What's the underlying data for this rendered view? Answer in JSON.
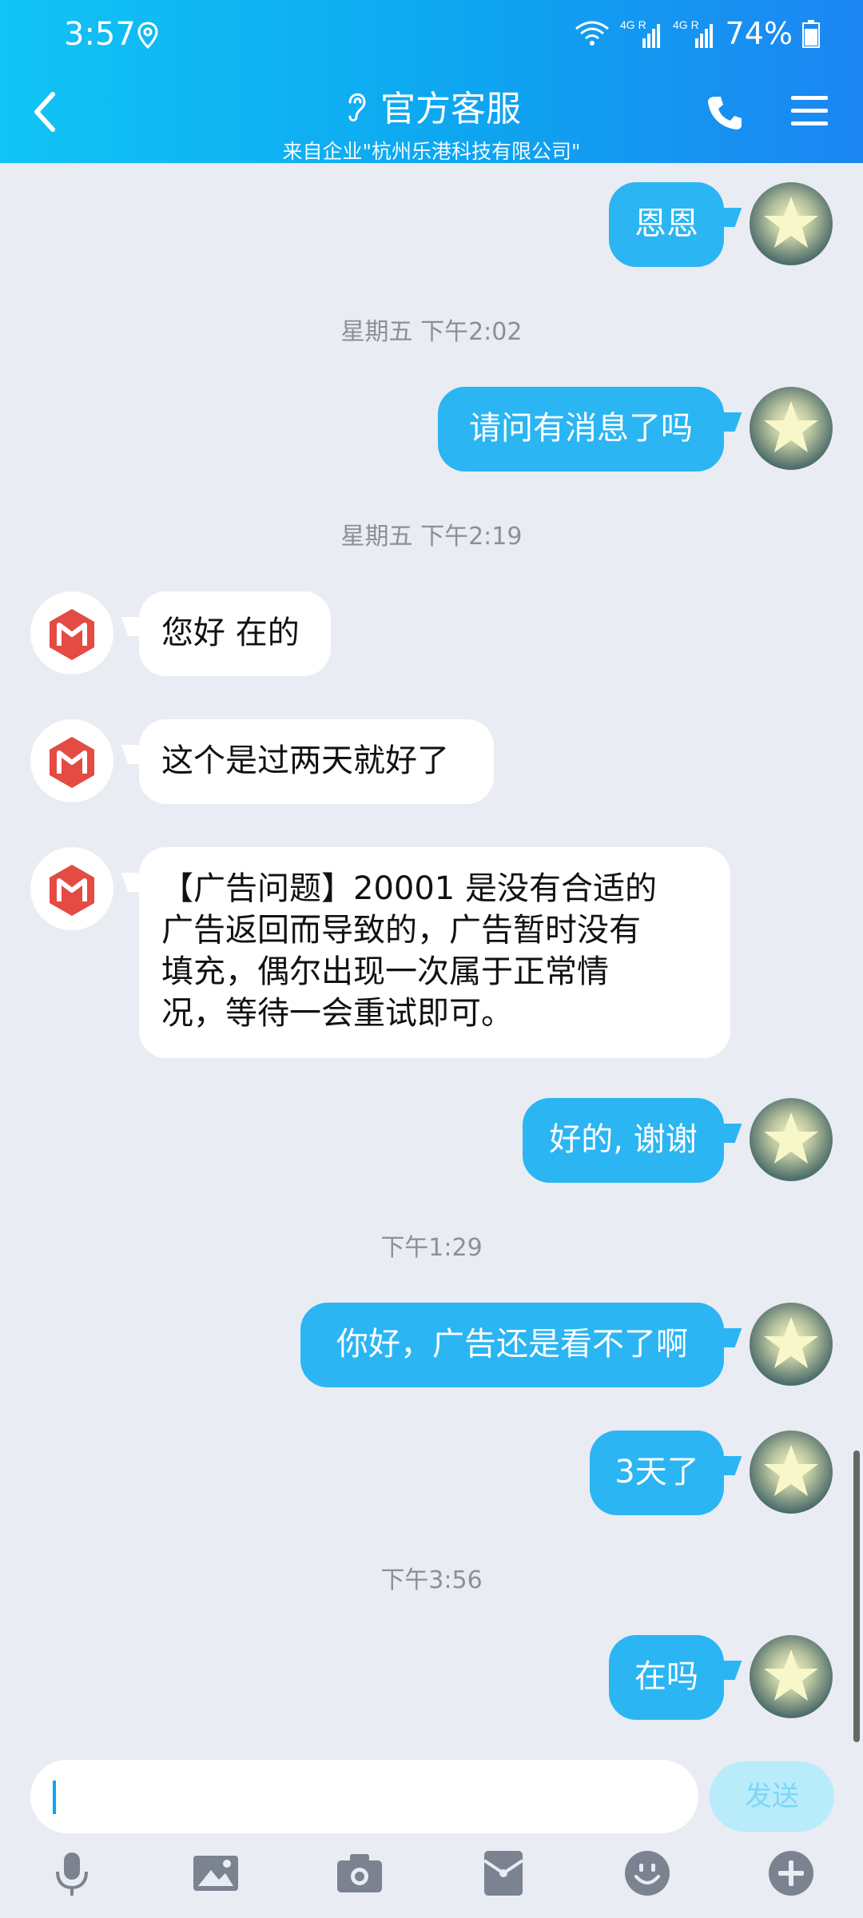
{
  "status_bar": {
    "time": "3:57",
    "battery": "74%",
    "net1": "4G R",
    "net2": "4G R"
  },
  "header": {
    "title": "官方客服",
    "subtitle": "来自企业\"杭州乐港科技有限公司\""
  },
  "messages": [
    {
      "type": "out",
      "text": "恩恩"
    },
    {
      "type": "time",
      "text": "星期五 下午2:02"
    },
    {
      "type": "out",
      "text": "请问有消息了吗"
    },
    {
      "type": "time",
      "text": "星期五 下午2:19"
    },
    {
      "type": "in",
      "text": "您好 在的"
    },
    {
      "type": "in",
      "text": "这个是过两天就好了"
    },
    {
      "type": "in",
      "lines": [
        "【广告问题】20001 是没有合适的",
        "广告返回而导致的，广告暂时没有",
        "填充，偶尔出现一次属于正常情",
        "况，等待一会重试即可。"
      ]
    },
    {
      "type": "out",
      "text": "好的, 谢谢"
    },
    {
      "type": "time",
      "text": "下午1:29"
    },
    {
      "type": "out",
      "text": "你好，广告还是看不了啊"
    },
    {
      "type": "out",
      "text": "3天了"
    },
    {
      "type": "time",
      "text": "下午3:56"
    },
    {
      "type": "out",
      "text": "在吗"
    }
  ],
  "composer": {
    "send_label": "发送",
    "placeholder": ""
  },
  "colors": {
    "accent": "#2bb5f3",
    "header_start": "#11c4f5",
    "header_end": "#1b86f2",
    "bg": "#e9ecf3",
    "brand_red": "#e34b43"
  },
  "toolbar_icons": [
    "microphone-icon",
    "image-icon",
    "camera-icon",
    "red-packet-icon",
    "emoji-icon",
    "plus-icon"
  ]
}
